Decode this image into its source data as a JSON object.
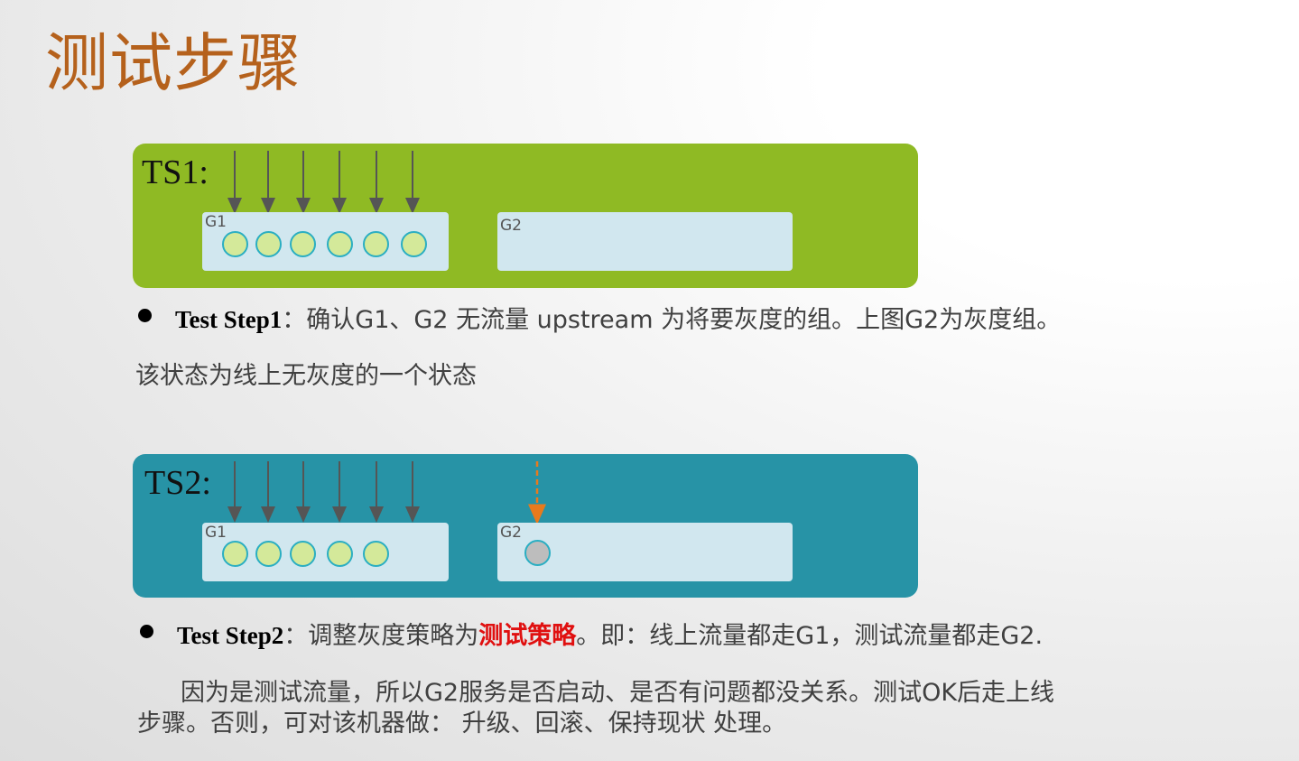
{
  "title": "测试步骤",
  "ts1": {
    "label": "TS1:",
    "g1_label": "G1",
    "g2_label": "G2"
  },
  "ts2": {
    "label": "TS2:",
    "g1_label": "G1",
    "g2_label": "G2"
  },
  "step1": {
    "name": "Test Step1",
    "text": "：确认G1、G2 无流量 upstream 为将要灰度的组。上图G2为灰度组。"
  },
  "state_note": "该状态为线上无灰度的一个状态",
  "step2": {
    "name": "Test Step2",
    "text_before": "：调整灰度策略为",
    "highlight": "测试策略",
    "text_after": "。即：线上流量都走G1，测试流量都走G2."
  },
  "para_line1": "因为是测试流量，所以G2服务是否启动、是否有问题都没关系。测试OK后走上线",
  "para_line2": "步骤。否则，可对该机器做： 升级、回滚、保持现状 处理。",
  "colors": {
    "title": "#b5611c",
    "ts1_panel": "#8fba24",
    "ts2_panel": "#2793a6",
    "group_box": "#d1e7ef",
    "node_fill": "#d4e99a",
    "node_border": "#2aaec2",
    "test_node": "#bdbdbd",
    "test_arrow": "#e87a1c",
    "highlight": "#e01010"
  }
}
